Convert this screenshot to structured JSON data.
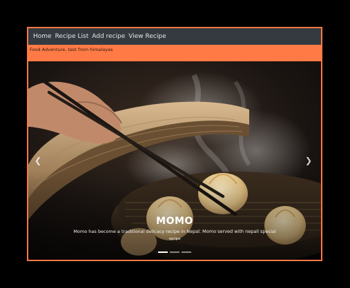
{
  "nav": {
    "items": [
      {
        "label": "Home"
      },
      {
        "label": "Recipe List"
      },
      {
        "label": "Add recipe"
      },
      {
        "label": "View Recipe"
      }
    ]
  },
  "tagline": "Food Adventure, test from himalayas",
  "carousel": {
    "slide_title": "MOMO",
    "slide_text": "Momo has become a traditional delicacy recipe in Nepal. Momo served with nepali special",
    "slide_link": "recipe",
    "prev_icon": "chevron-left-icon",
    "next_icon": "chevron-right-icon",
    "active_index": 0,
    "indicator_count": 3
  },
  "colors": {
    "accent": "#ff7a45",
    "navbar": "#343a40",
    "background": "#000000"
  }
}
